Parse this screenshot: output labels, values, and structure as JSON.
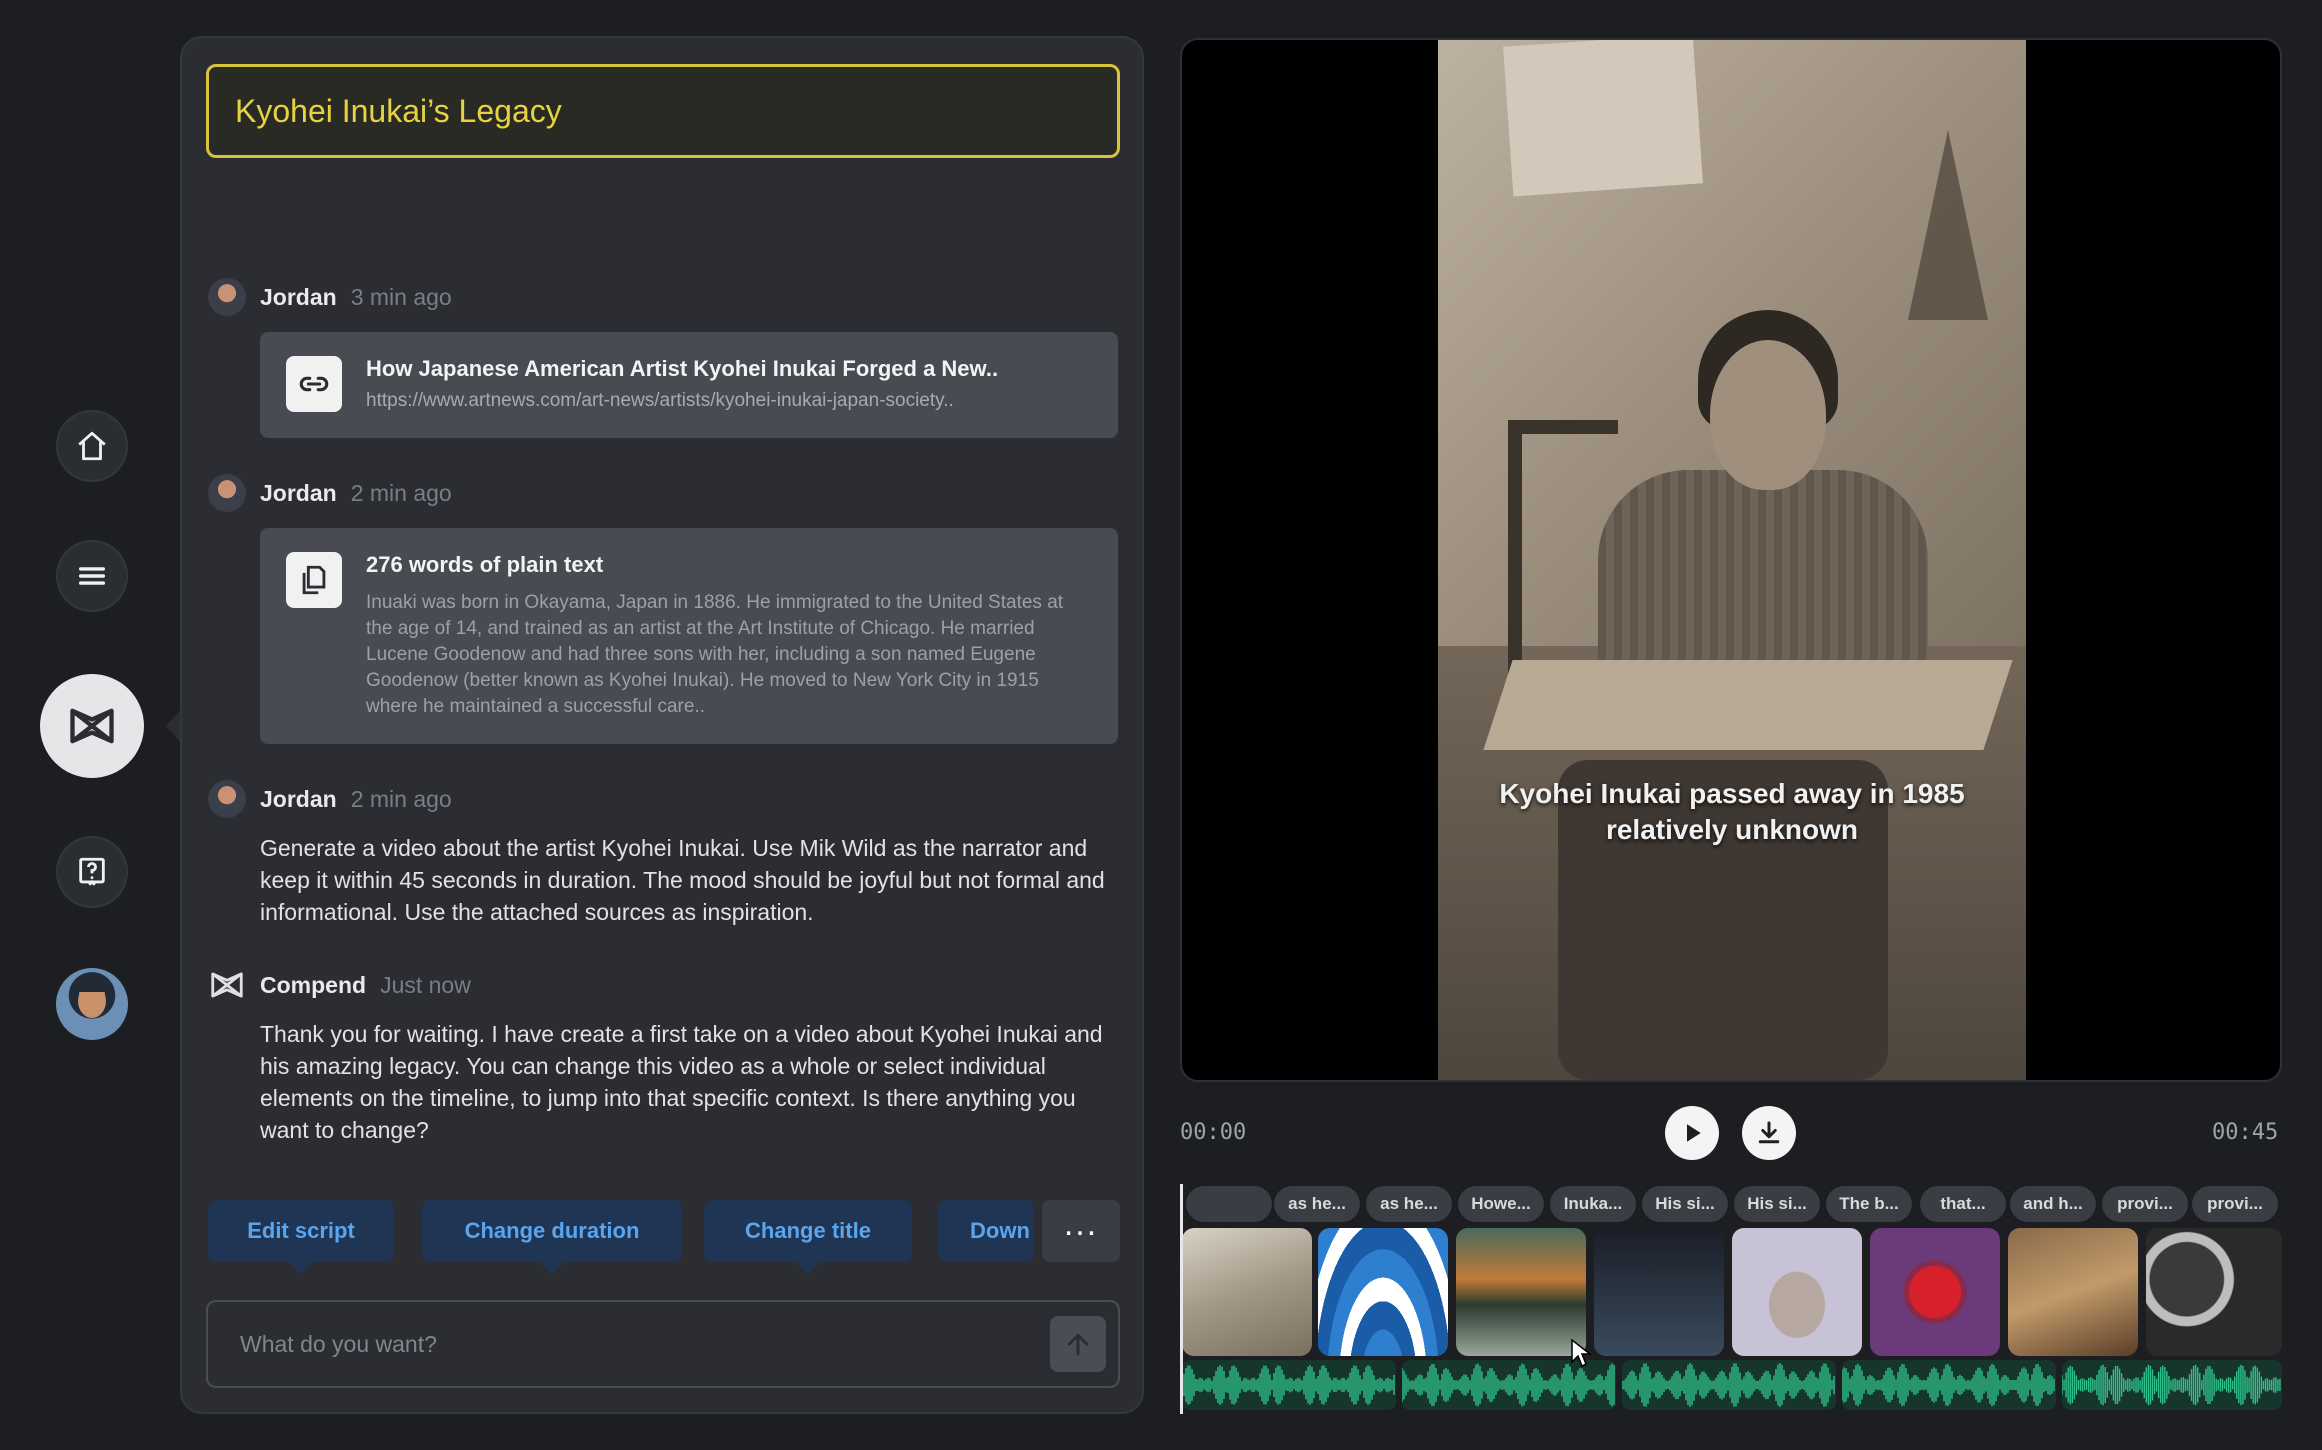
{
  "sidebar": {
    "items": [
      {
        "name": "home",
        "icon": "home-icon"
      },
      {
        "name": "menu",
        "icon": "menu-icon"
      },
      {
        "name": "compend",
        "icon": "compend-logo-icon"
      },
      {
        "name": "help",
        "icon": "help-icon"
      },
      {
        "name": "profile",
        "icon": "avatar"
      }
    ]
  },
  "chat": {
    "title": "Kyohei Inukai’s Legacy",
    "messages": [
      {
        "author": "Jordan",
        "time": "3 min ago",
        "attachment": {
          "icon": "link-icon",
          "title": "How Japanese American Artist Kyohei Inukai Forged a New..",
          "url": "https://www.artnews.com/art-news/artists/kyohei-inukai-japan-society.."
        }
      },
      {
        "author": "Jordan",
        "time": "2 min ago",
        "attachment": {
          "icon": "document-icon",
          "title": "276 words of plain text",
          "body": "Inuaki was born in Okayama, Japan in 1886. He immigrated to the United States at the age of 14, and trained as an artist at the Art Institute of Chicago. He married Lucene Goodenow and had three sons with her, including a son named Eugene Goodenow (better known as Kyohei Inukai). He moved to New York City in 1915 where he maintained a successful care.."
        }
      },
      {
        "author": "Jordan",
        "time": "2 min ago",
        "text": "Generate a video about the artist Kyohei Inukai. Use Mik Wild as the narrator and keep it within 45 seconds in duration. The mood should be joyful but not formal and informational. Use the attached sources as inspiration."
      },
      {
        "author": "Compend",
        "time": "Just now",
        "text": "Thank you for waiting. I have create a first take on a video about Kyohei Inukai and his amazing legacy. You can change this video as a whole or select individual elements on the timeline, to jump into that specific context. Is there anything you want to change?"
      }
    ],
    "suggestions": [
      "Edit script",
      "Change duration",
      "Change title",
      "Down"
    ],
    "more_label": "...",
    "input_placeholder": "What do you want?"
  },
  "player": {
    "caption_line1": "Kyohei Inukai passed away in 1985",
    "caption_line2": "relatively unknown",
    "time_start": "00:00",
    "time_end": "00:45",
    "progress": 0
  },
  "timeline": {
    "labels": [
      "",
      "as he...",
      "as he...",
      "Howe...",
      "Inuka...",
      "His si...",
      "His si...",
      "The b...",
      "that...",
      "and h...",
      "provi...",
      "provi..."
    ]
  },
  "colors": {
    "accent_yellow": "#e7d33f",
    "chip_bg": "#1f3553",
    "chip_text": "#5aa5f0",
    "waveform": "#2fbf8a"
  }
}
